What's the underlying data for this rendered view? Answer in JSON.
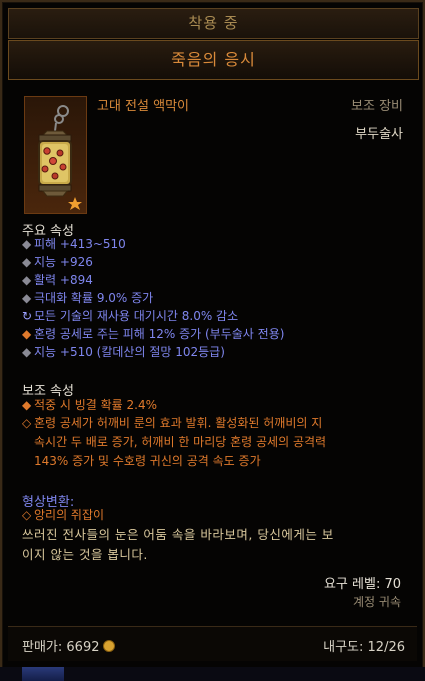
{
  "header": {
    "equipped_label": "착용 중",
    "item_name": "죽음의 응시"
  },
  "item": {
    "type": "고대 전설 액막이",
    "slot": "보조 장비",
    "class": "부두술사",
    "icon": "lantern-amulet-icon",
    "ancient_star_color": "#f0a030"
  },
  "primary": {
    "title": "주요 속성",
    "stats": [
      "피해 +413~510",
      "지능 +926",
      "활력 +894",
      "극대화 확률 9.0% 증가",
      "모든 기술의 재사용 대기시간 8.0% 감소",
      "혼령 공세로 주는 피해 12% 증가 (부두술사 전용)",
      "지능 +510 (칼데산의 절망 102등급)"
    ]
  },
  "secondary": {
    "title": "보조 속성",
    "stat1": "적중 시 빙결 확률 2.4%",
    "legendary_line1": "혼령 공세가 허깨비 룬의 효과 발휘. 활성화된 허깨비의 지",
    "legendary_line2": "속시간 두 배로 증가, 허깨비 한 마리당 혼령 공세의 공격력",
    "legendary_line3": "143% 증가 및 수호령 귀신의 공격 속도 증가"
  },
  "transmog": {
    "title": "형상변환:",
    "value": "앙리의 쥐잡이"
  },
  "flavor": {
    "line1": "쓰러진 전사들의 눈은 어둠 속을 바라보며, 당신에게는 보",
    "line2": "이지 않는 것을 봅니다."
  },
  "requirements": {
    "level": "요구 레벨: 70",
    "bound": "계정 귀속"
  },
  "footer": {
    "sell_label": "판매가:",
    "sell_value": "6692",
    "durability_label": "내구도:",
    "durability_value": "12/26"
  },
  "colors": {
    "magic_blue": "#7f86ee",
    "legendary_orange": "#e07a2c",
    "flavor_gold": "#d8c79c"
  }
}
